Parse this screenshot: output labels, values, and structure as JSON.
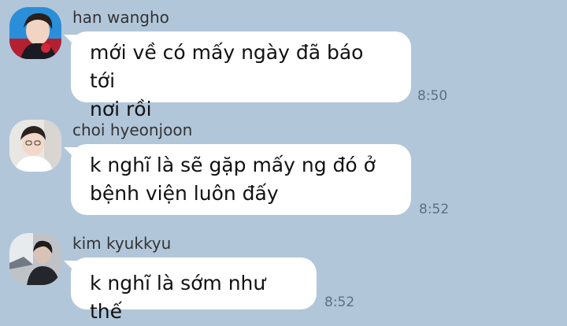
{
  "messages": [
    {
      "sender": "han wangho",
      "text": "mới về có mấy ngày đã báo tới\nnơi rồi",
      "time": "8:50",
      "avatar": "profile-photo-han-wangho"
    },
    {
      "sender": "choi hyeonjoon",
      "text": "k nghĩ là sẽ gặp mấy ng đó ở\nbệnh viện luôn đấy",
      "time": "8:52",
      "avatar": "profile-photo-choi-hyeonjoon"
    },
    {
      "sender": "kim kyukkyu",
      "text": "k nghĩ là sớm như thế",
      "time": "8:52",
      "avatar": "profile-photo-kim-kyukkyu"
    }
  ],
  "colors": {
    "background": "#b2c6da",
    "bubble": "#ffffff",
    "timestamp": "#5d6f82"
  }
}
